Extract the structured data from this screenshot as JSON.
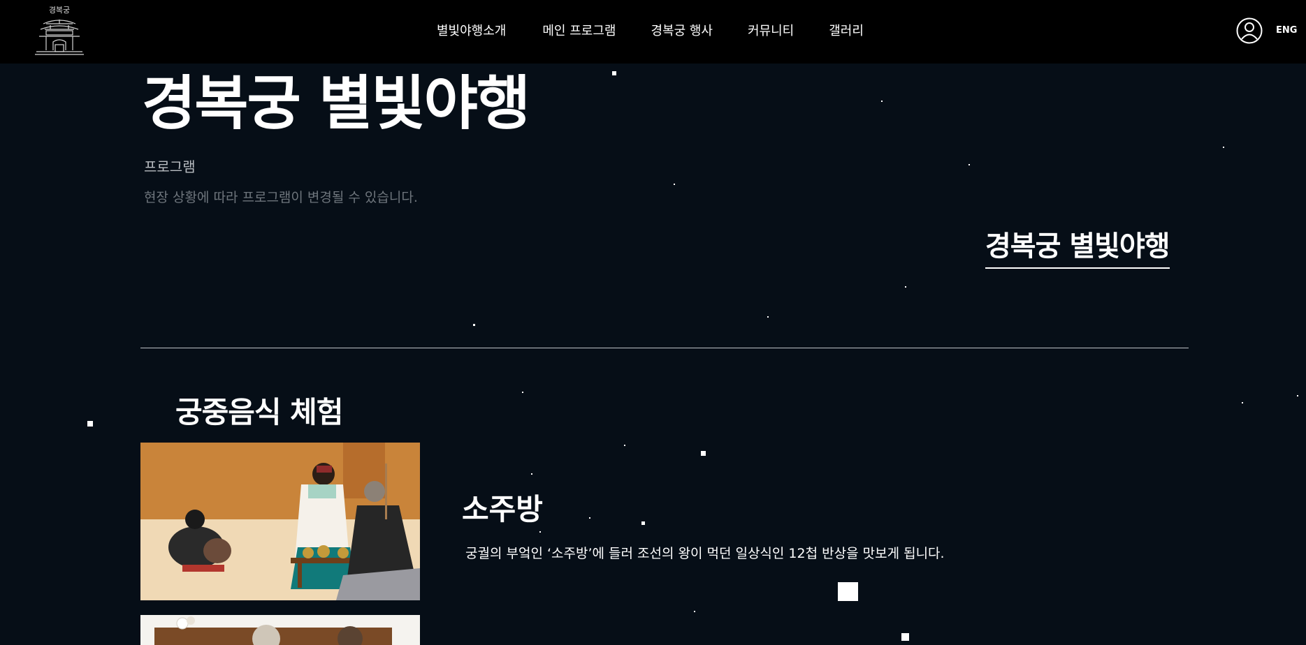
{
  "header": {
    "logo_text": "경복궁",
    "nav": [
      "별빛야행소개",
      "메인 프로그램",
      "경복궁 행사",
      "커뮤니티",
      "갤러리"
    ],
    "lang": "ENG"
  },
  "hero": {
    "title": "경복궁 별빛야행",
    "subtitle": "프로그램",
    "note": "현장 상황에 따라 프로그램이 변경될 수 있습니다.",
    "side_title": "경복궁 별빛야행"
  },
  "section": {
    "title": "궁중음식 체험",
    "card": {
      "title": "소주방",
      "description": "궁궐의 부엌인 ‘소주방’에 들러 조선의 왕이 먹던 일상식인 12첩 반상을 맛보게 됩니다."
    }
  },
  "colors": {
    "background": "#060e17",
    "header": "#000000",
    "text": "#ffffff",
    "muted": "#6e757c"
  }
}
